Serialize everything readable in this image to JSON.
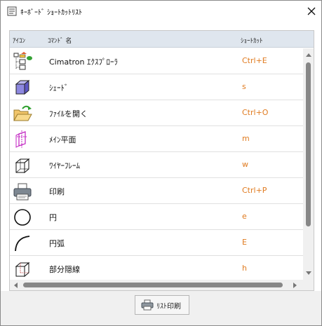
{
  "window": {
    "title": "ｷｰﾎﾞｰﾄﾞ ｼｮｰﾄｶｯﾄﾘｽﾄ",
    "close_icon": "close-icon"
  },
  "table": {
    "columns": [
      "ｱｲｺﾝ",
      "ｺﾏﾝﾄﾞ 名",
      "ｼｮｰﾄｶｯﾄ"
    ],
    "rows": [
      {
        "icon": "cimatron-explorer-icon",
        "name": "Cimatron ｴｸｽﾌﾟﾛｰﾗ",
        "shortcut": "Ctrl+E"
      },
      {
        "icon": "shade-cube-icon",
        "name": "ｼｪｰﾄﾞ",
        "shortcut": "s"
      },
      {
        "icon": "open-folder-icon",
        "name": "ﾌｧｲﾙを開く",
        "shortcut": "Ctrl+O"
      },
      {
        "icon": "main-plane-icon",
        "name": "ﾒｲﾝ平面",
        "shortcut": "m"
      },
      {
        "icon": "wireframe-cube-icon",
        "name": "ﾜｲﾔｰﾌﾚｰﾑ",
        "shortcut": "w"
      },
      {
        "icon": "printer-icon",
        "name": "印刷",
        "shortcut": "Ctrl+P"
      },
      {
        "icon": "circle-icon",
        "name": "円",
        "shortcut": "e"
      },
      {
        "icon": "arc-icon",
        "name": "円弧",
        "shortcut": "E"
      },
      {
        "icon": "partial-hidden-line-icon",
        "name": "部分隠線",
        "shortcut": "h"
      }
    ]
  },
  "footer": {
    "print_list_label": "ﾘｽﾄ印刷"
  },
  "colors": {
    "shortcut_text": "#e07b20",
    "header_bg": "#dfe6ee",
    "scroll_thumb": "#878787"
  }
}
